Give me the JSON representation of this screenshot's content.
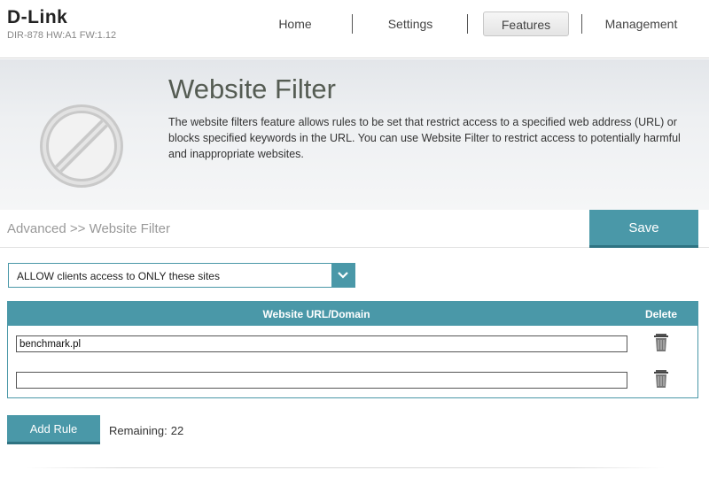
{
  "header": {
    "logo": "D-Link",
    "model_info": "DIR-878 HW:A1 FW:1.12",
    "nav": [
      {
        "label": "Home",
        "active": false
      },
      {
        "label": "Settings",
        "active": false
      },
      {
        "label": "Features",
        "active": true
      },
      {
        "label": "Management",
        "active": false
      }
    ]
  },
  "hero": {
    "icon": "prohibited-icon",
    "title": "Website Filter",
    "description": "The website filters feature allows rules to be set that restrict access to a specified web address (URL) or blocks specified keywords in the URL. You can use Website Filter to restrict access to potentially harmful and inappropriate websites."
  },
  "breadcrumb": "Advanced >> Website Filter",
  "save_label": "Save",
  "filter_mode": {
    "selected": "ALLOW clients access to ONLY these sites",
    "icon": "chevron-down-icon"
  },
  "table": {
    "headers": {
      "url": "Website URL/Domain",
      "delete": "Delete"
    },
    "rows": [
      {
        "url": "benchmark.pl",
        "delete_icon": "trash-icon"
      },
      {
        "url": "",
        "delete_icon": "trash-icon"
      }
    ]
  },
  "add_rule_label": "Add Rule",
  "remaining": {
    "label": "Remaining:",
    "count": "22"
  },
  "colors": {
    "accent": "#4a98a8",
    "accent_dark": "#2f7382",
    "title": "#555c53"
  }
}
